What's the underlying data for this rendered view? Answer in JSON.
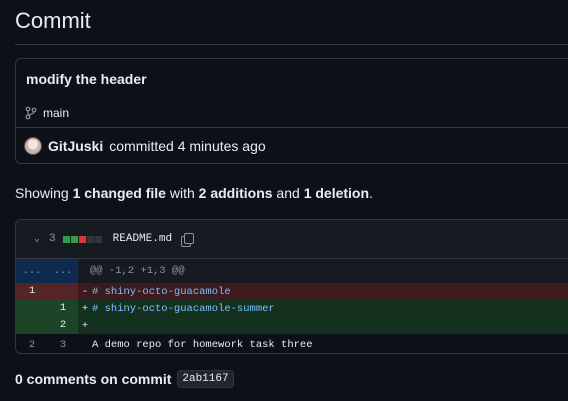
{
  "page": {
    "title": "Commit"
  },
  "commit": {
    "message": "modify the header",
    "branch": "main",
    "author": "GitJuski",
    "committed_text": "committed 4 minutes ago",
    "sha": "2ab1167"
  },
  "summary": {
    "prefix": "Showing ",
    "changed_files": "1 changed file",
    "with": " with ",
    "additions": "2 additions",
    "and": " and ",
    "deletions": "1 deletion",
    "suffix": "."
  },
  "diff": {
    "change_count": "3",
    "filename": "README.md",
    "hunk_header": "@@ -1,2 +1,3 @@",
    "expand_left": "...",
    "expand_right": "...",
    "lines": [
      {
        "old": "1",
        "new": "",
        "marker": "-",
        "text": "# shiny-octo-guacamole"
      },
      {
        "old": "",
        "new": "1",
        "marker": "+",
        "text": "# shiny-octo-guacamole-summer"
      },
      {
        "old": "",
        "new": "2",
        "marker": "+",
        "text": ""
      },
      {
        "old": "2",
        "new": "3",
        "marker": "",
        "text": "A demo repo for homework task three"
      }
    ]
  },
  "comments": {
    "label": "0 comments on commit"
  },
  "colors": {
    "background": "#0d1117",
    "border": "#30363d",
    "addition": "#2ea043",
    "deletion": "#da3633",
    "hunk": "#0f2a4f"
  },
  "icons": [
    "git-branch-icon",
    "avatar",
    "chevron-down-icon",
    "copy-icon"
  ]
}
